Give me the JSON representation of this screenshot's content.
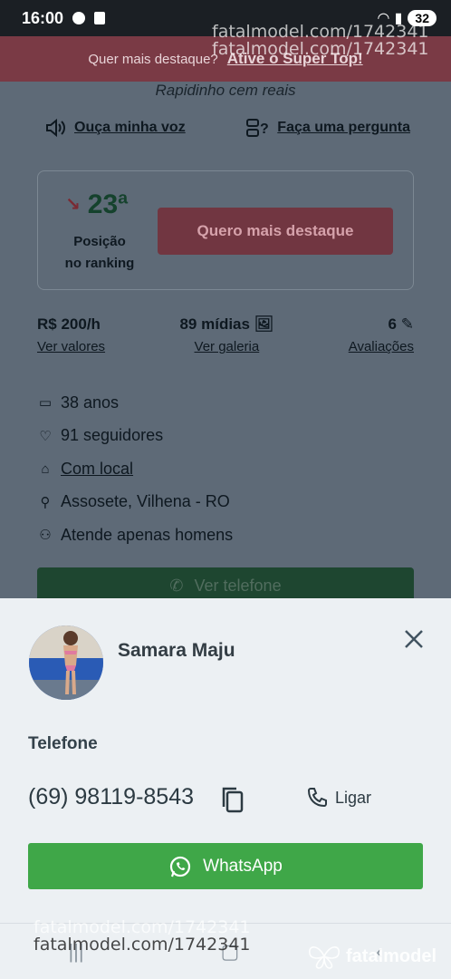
{
  "status_bar": {
    "time": "16:00",
    "battery": "32"
  },
  "promo": {
    "text": "Quer mais destaque?",
    "cta": "Ative o Super Top!"
  },
  "profile": {
    "tagline": "Rapidinho cem reais",
    "actions": {
      "voice": "Ouça minha voz",
      "question": "Faça uma pergunta"
    },
    "ranking": {
      "position": "23ª",
      "label_line1": "Posição",
      "label_line2": "no ranking",
      "button": "Quero mais destaque"
    },
    "stats": {
      "price": "R$ 200/h",
      "price_link": "Ver valores",
      "media": "89 mídias",
      "media_link": "Ver galeria",
      "reviews": "6",
      "reviews_link": "Avaliações"
    },
    "info": {
      "age": "38 anos",
      "followers": "91 seguidores",
      "place": "Com local",
      "location": "Assosete, Vilhena - RO",
      "attends": "Atende apenas homens"
    },
    "phone_button": "Ver telefone"
  },
  "sheet": {
    "name": "Samara Maju",
    "phone_title": "Telefone",
    "phone_number": "(69) 98119-8543",
    "call_label": "Ligar",
    "whatsapp_label": "WhatsApp"
  },
  "watermarks": {
    "url": "fatalmodel.com/1742341",
    "logo": "fatalmodel"
  },
  "colors": {
    "whatsapp": "#3fa748",
    "promo": "#7a3a45",
    "sheet_bg": "#ecf0f3"
  }
}
